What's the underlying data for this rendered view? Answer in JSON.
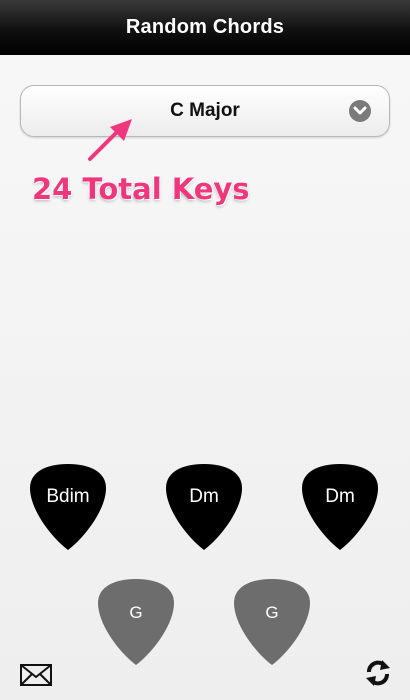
{
  "header": {
    "title": "Random Chords"
  },
  "key_selector": {
    "value": "C Major",
    "icon": "chevron-down-icon"
  },
  "annotation": {
    "text": "24 Total Keys",
    "color": "#f0377e"
  },
  "chords": {
    "top": [
      "Bdim",
      "Dm",
      "Dm"
    ],
    "bottom": [
      "G",
      "G"
    ]
  },
  "colors": {
    "pick_dark": "#000000",
    "pick_grey": "#6d6d6d",
    "header_bg": "#111111"
  },
  "toolbar": {
    "left_icon": "mail-icon",
    "right_icon": "refresh-icon"
  }
}
